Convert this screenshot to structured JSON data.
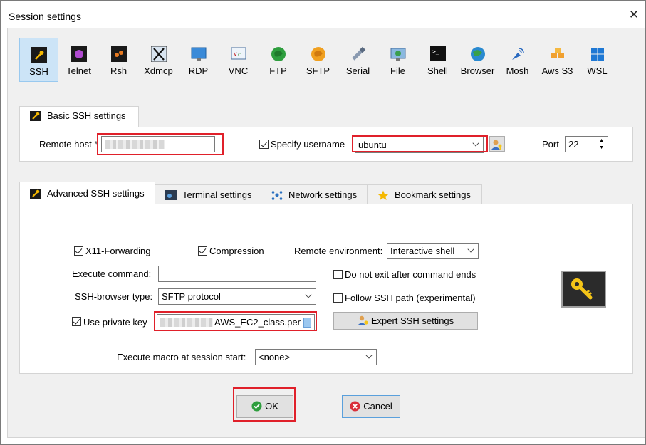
{
  "window": {
    "title": "Session settings",
    "close_glyph": "✕"
  },
  "session_types": [
    {
      "label": "SSH",
      "icon": "ssh-icon",
      "active": true
    },
    {
      "label": "Telnet",
      "icon": "telnet-icon"
    },
    {
      "label": "Rsh",
      "icon": "rsh-icon"
    },
    {
      "label": "Xdmcp",
      "icon": "xdmcp-icon"
    },
    {
      "label": "RDP",
      "icon": "rdp-icon"
    },
    {
      "label": "VNC",
      "icon": "vnc-icon"
    },
    {
      "label": "FTP",
      "icon": "ftp-icon"
    },
    {
      "label": "SFTP",
      "icon": "sftp-icon"
    },
    {
      "label": "Serial",
      "icon": "serial-icon"
    },
    {
      "label": "File",
      "icon": "file-icon"
    },
    {
      "label": "Shell",
      "icon": "shell-icon"
    },
    {
      "label": "Browser",
      "icon": "browser-icon"
    },
    {
      "label": "Mosh",
      "icon": "mosh-icon"
    },
    {
      "label": "Aws S3",
      "icon": "aws-s3-icon"
    },
    {
      "label": "WSL",
      "icon": "wsl-icon"
    }
  ],
  "basic": {
    "tab_label": "Basic SSH settings",
    "remote_host_label": "Remote host",
    "required_mark": "*",
    "specify_username_label": "Specify username",
    "specify_username_checked": true,
    "username_value": "ubuntu",
    "port_label": "Port",
    "port_value": "22"
  },
  "advanced_tabs": [
    {
      "label": "Advanced SSH settings",
      "icon": "wrench-icon",
      "active": true
    },
    {
      "label": "Terminal settings",
      "icon": "terminal-icon"
    },
    {
      "label": "Network settings",
      "icon": "network-icon"
    },
    {
      "label": "Bookmark settings",
      "icon": "star-icon"
    }
  ],
  "advanced": {
    "x11_label": "X11-Forwarding",
    "x11_checked": true,
    "compression_label": "Compression",
    "compression_checked": true,
    "remote_env_label": "Remote environment:",
    "remote_env_value": "Interactive shell",
    "execute_command_label": "Execute command:",
    "execute_command_value": "",
    "do_not_exit_label": "Do not exit after command ends",
    "do_not_exit_checked": false,
    "browser_type_label": "SSH-browser type:",
    "browser_type_value": "SFTP protocol",
    "follow_path_label": "Follow SSH path (experimental)",
    "follow_path_checked": false,
    "private_key_label": "Use private key",
    "private_key_checked": true,
    "private_key_value": "AWS_EC2_class.per",
    "expert_button_label": "Expert SSH settings",
    "macro_label": "Execute macro at session start:",
    "macro_value": "<none>"
  },
  "buttons": {
    "ok_label": "OK",
    "cancel_label": "Cancel"
  },
  "colors": {
    "highlight_red": "#e0202a",
    "selected_bg": "#cce4f7",
    "key_bg": "#2b2b2b",
    "key_gold": "#f5c518"
  }
}
